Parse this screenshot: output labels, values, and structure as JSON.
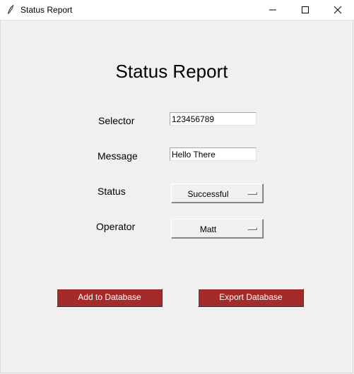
{
  "window": {
    "title": "Status Report",
    "controls": {
      "minimize": "minimize-icon",
      "maximize": "maximize-icon",
      "close": "close-icon"
    }
  },
  "form": {
    "heading": "Status Report",
    "selector": {
      "label": "Selector",
      "value": "123456789"
    },
    "message": {
      "label": "Message",
      "value": "Hello There"
    },
    "status": {
      "label": "Status",
      "selected": "Successful"
    },
    "operator": {
      "label": "Operator",
      "selected": "Matt"
    }
  },
  "buttons": {
    "add": "Add to Database",
    "export": "Export Database"
  },
  "colors": {
    "background": "#f0f0f0",
    "button": "#a52a2a",
    "button_text": "#ffffff"
  }
}
